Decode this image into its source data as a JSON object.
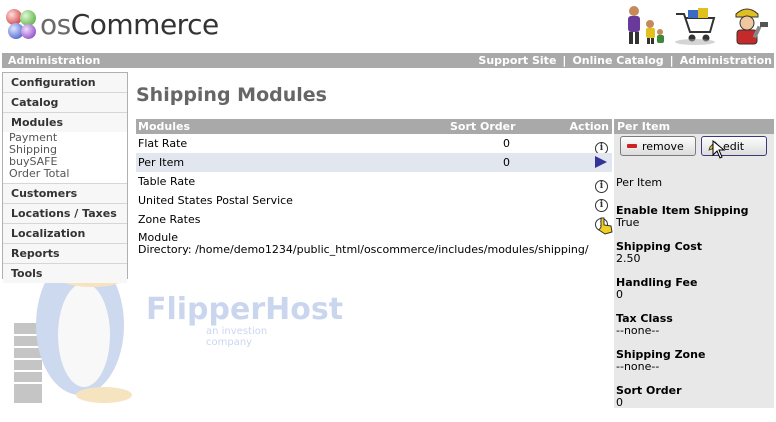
{
  "header": {
    "logo_text_os": "os",
    "logo_text_commerce": "Commerce",
    "icons": [
      "family-shopping-icon",
      "shopping-cart-icon",
      "worker-icon"
    ]
  },
  "topbar": {
    "left_label": "Administration",
    "links": [
      "Support Site",
      "Online Catalog",
      "Administration"
    ],
    "separator": "|"
  },
  "sidebar": {
    "items": [
      {
        "label": "Configuration"
      },
      {
        "label": "Catalog"
      },
      {
        "label": "Modules",
        "sub": [
          "Payment",
          "Shipping",
          "buySAFE",
          "Order Total"
        ]
      },
      {
        "label": "Customers"
      },
      {
        "label": "Locations / Taxes"
      },
      {
        "label": "Localization"
      },
      {
        "label": "Reports"
      },
      {
        "label": "Tools"
      }
    ]
  },
  "watermark": {
    "text": "FlipperHost",
    "tagline": "an investion company"
  },
  "page_title": "Shipping Modules",
  "table": {
    "headers": {
      "modules": "Modules",
      "sort_order": "Sort Order",
      "action": "Action"
    },
    "rows": [
      {
        "name": "Flat Rate",
        "sort": "0",
        "action_icon": "info-icon",
        "selected": false
      },
      {
        "name": "Per Item",
        "sort": "0",
        "action_icon": "arrow-right-icon",
        "selected": true
      },
      {
        "name": "Table Rate",
        "sort": "",
        "action_icon": "info-icon",
        "selected": false
      },
      {
        "name": "United States Postal Service",
        "sort": "",
        "action_icon": "info-icon",
        "selected": false
      },
      {
        "name": "Zone Rates",
        "sort": "",
        "action_icon": "info-icon",
        "selected": false
      }
    ],
    "module_dir_label": "Module",
    "module_dir_value": "Directory: /home/demo1234/public_html/oscommerce/includes/modules/shipping/"
  },
  "panel": {
    "title": "Per Item",
    "remove_label": "remove",
    "edit_label": "edit",
    "description": "Per Item",
    "fields": [
      {
        "label": "Enable Item Shipping",
        "value": "True"
      },
      {
        "label": "Shipping Cost",
        "value": "2.50"
      },
      {
        "label": "Handling Fee",
        "value": "0"
      },
      {
        "label": "Tax Class",
        "value": "--none--"
      },
      {
        "label": "Shipping Zone",
        "value": "--none--"
      },
      {
        "label": "Sort Order",
        "value": "0"
      }
    ]
  },
  "colors": {
    "bar": "#a9a9a9",
    "selected_row": "#e2e6ee",
    "panel_bg": "#e8e8e8"
  }
}
